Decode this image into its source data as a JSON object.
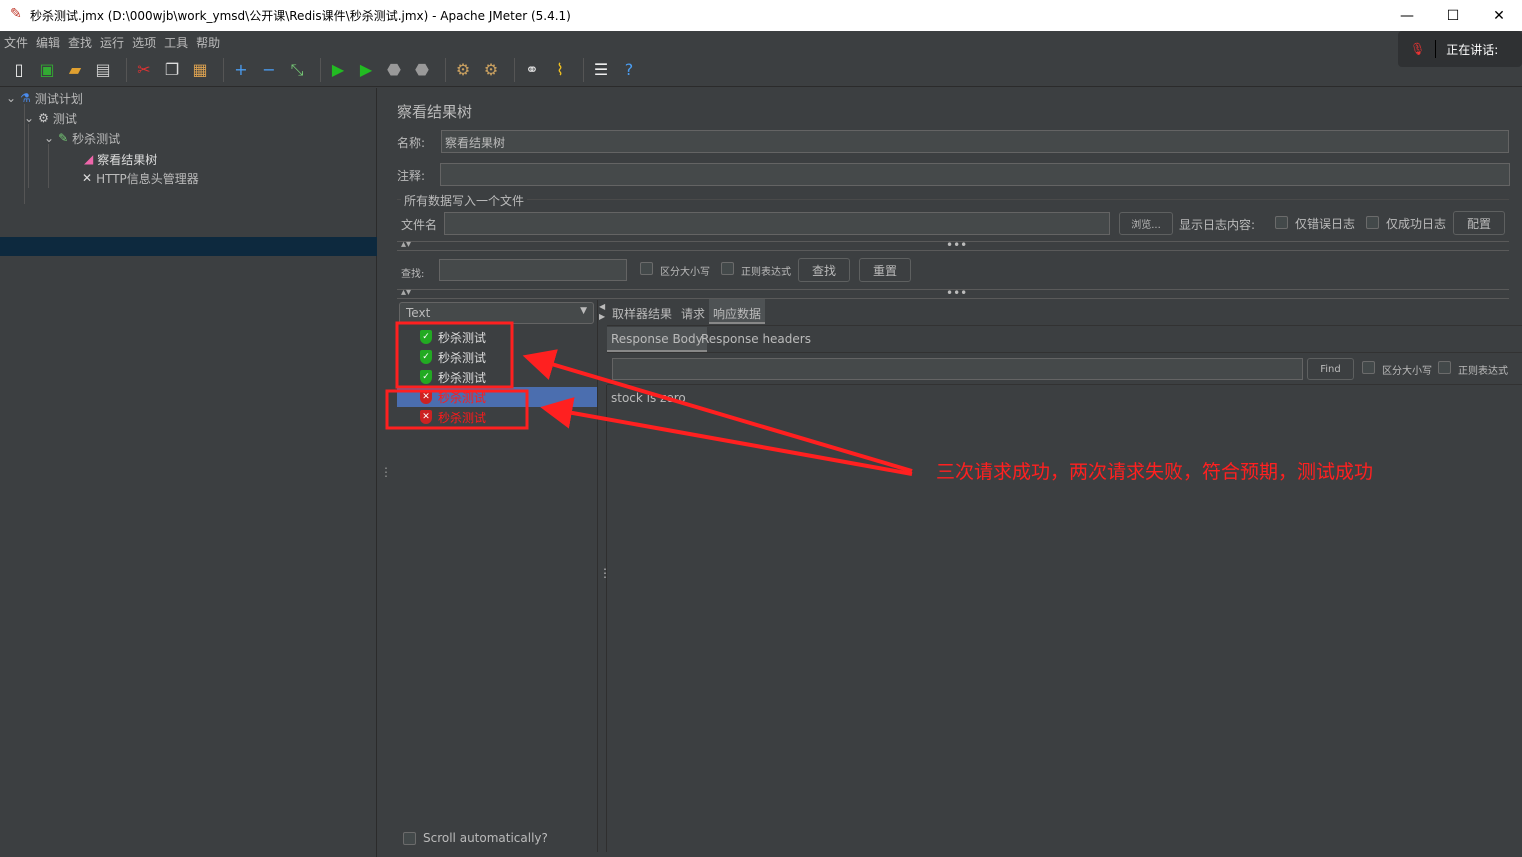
{
  "window": {
    "title": "秒杀测试.jmx (D:\\000wjb\\work_ymsd\\公开课\\Redis课件\\秒杀测试.jmx) - Apache JMeter (5.4.1)",
    "minimize": "—",
    "maximize": "☐",
    "close": "✕"
  },
  "menu": [
    "文件",
    "编辑",
    "查找",
    "运行",
    "选项",
    "工具",
    "帮助"
  ],
  "toolbar": [
    "new-icon",
    "templates-icon",
    "open-icon",
    "save-icon",
    "cut-icon",
    "copy-icon",
    "paste-icon",
    "expand-icon",
    "collapse-icon",
    "toggle-icon",
    "start-icon",
    "start-no-pause-icon",
    "stop-icon",
    "shutdown-icon",
    "clear-icon",
    "clear-all-icon",
    "search-icon",
    "reset-search-icon",
    "function-helper-icon",
    "help-icon"
  ],
  "speaking": {
    "label": "正在讲话:"
  },
  "tree": [
    {
      "label": "测试计划"
    },
    {
      "label": "测试"
    },
    {
      "label": "秒杀测试"
    },
    {
      "label": "察看结果树"
    },
    {
      "label": "HTTP信息头管理器"
    }
  ],
  "panel": {
    "title": "察看结果树",
    "name_label": "名称:",
    "name_value": "察看结果树",
    "comment_label": "注释:",
    "comment_value": "",
    "file_section": "所有数据写入一个文件",
    "filename_label": "文件名",
    "filename_value": "",
    "browse": "浏览...",
    "log_label": "显示日志内容:",
    "errors_only": "仅错误日志",
    "success_only": "仅成功日志",
    "configure": "配置",
    "search_label": "查找:",
    "search_value": "",
    "case_sensitive": "区分大小写",
    "regex": "正则表达式",
    "find": "查找",
    "reset": "重置",
    "renderer": "Text",
    "results": [
      {
        "label": "秒杀测试",
        "status": "success"
      },
      {
        "label": "秒杀测试",
        "status": "success"
      },
      {
        "label": "秒杀测试",
        "status": "success"
      },
      {
        "label": "秒杀测试",
        "status": "failure",
        "selected": true
      },
      {
        "label": "秒杀测试",
        "status": "failure"
      }
    ],
    "scroll_auto": "Scroll automatically?",
    "tabs": [
      "取样器结果",
      "请求",
      "响应数据"
    ],
    "active_tab": "响应数据",
    "subtabs": [
      "Response Body",
      "Response headers"
    ],
    "body_find": "Find",
    "body_case": "区分大小写",
    "body_regex": "正则表达式",
    "response_text": "stock is zero"
  },
  "annotation": {
    "text": "三次请求成功，两次请求失败，符合预期，测试成功",
    "color": "#ff2020"
  },
  "colors": {
    "background": "#3c3f41",
    "selection": "#4b6eaf",
    "tree_selection": "#0d293e",
    "success": "#22aa22",
    "failure": "#cc2222"
  }
}
